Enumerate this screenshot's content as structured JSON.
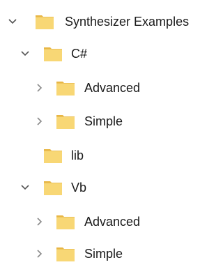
{
  "tree": {
    "items": [
      {
        "label": "Synthesizer Examples",
        "level": 0,
        "state": "expanded",
        "icon": "folder-icon"
      },
      {
        "label": "C#",
        "level": 1,
        "state": "expanded",
        "icon": "folder-icon"
      },
      {
        "label": "Advanced",
        "level": 2,
        "state": "collapsed",
        "icon": "folder-icon"
      },
      {
        "label": "Simple",
        "level": 2,
        "state": "collapsed",
        "icon": "folder-icon"
      },
      {
        "label": "lib",
        "level": 1,
        "state": "leaf",
        "icon": "folder-icon"
      },
      {
        "label": "Vb",
        "level": 1,
        "state": "expanded",
        "icon": "folder-icon"
      },
      {
        "label": "Advanced",
        "level": 2,
        "state": "collapsed",
        "icon": "folder-icon"
      },
      {
        "label": "Simple",
        "level": 2,
        "state": "collapsed",
        "icon": "folder-icon"
      }
    ]
  },
  "colors": {
    "folder_fill": "#F8D775",
    "folder_back": "#E8B645",
    "chevron": "#555555",
    "text": "#1A1A1A"
  }
}
